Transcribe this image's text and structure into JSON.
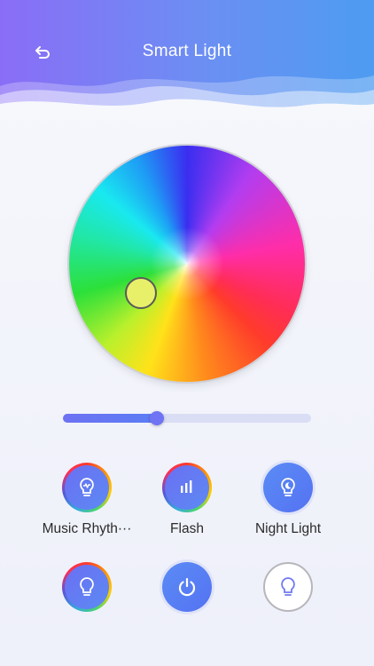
{
  "header": {
    "title": "Smart Light",
    "back_icon": "back-arrow-icon",
    "gradient": [
      "#8a6df6",
      "#4d9cf1"
    ]
  },
  "color_wheel": {
    "selected_color": "#e8f06a"
  },
  "brightness": {
    "value_percent": 38,
    "accent": "#6f74f4"
  },
  "modes": [
    {
      "label": "Music Rhyth···",
      "icon": "music-bulb-icon",
      "style": "rainbow"
    },
    {
      "label": "Flash",
      "icon": "flash-bars-icon",
      "style": "rainbow"
    },
    {
      "label": "Night Light",
      "icon": "moon-bulb-icon",
      "style": "blue"
    }
  ],
  "controls": [
    {
      "icon": "bulb-icon",
      "style": "rainbow"
    },
    {
      "icon": "power-icon",
      "style": "blue"
    },
    {
      "icon": "bulb-icon",
      "style": "outline"
    }
  ]
}
